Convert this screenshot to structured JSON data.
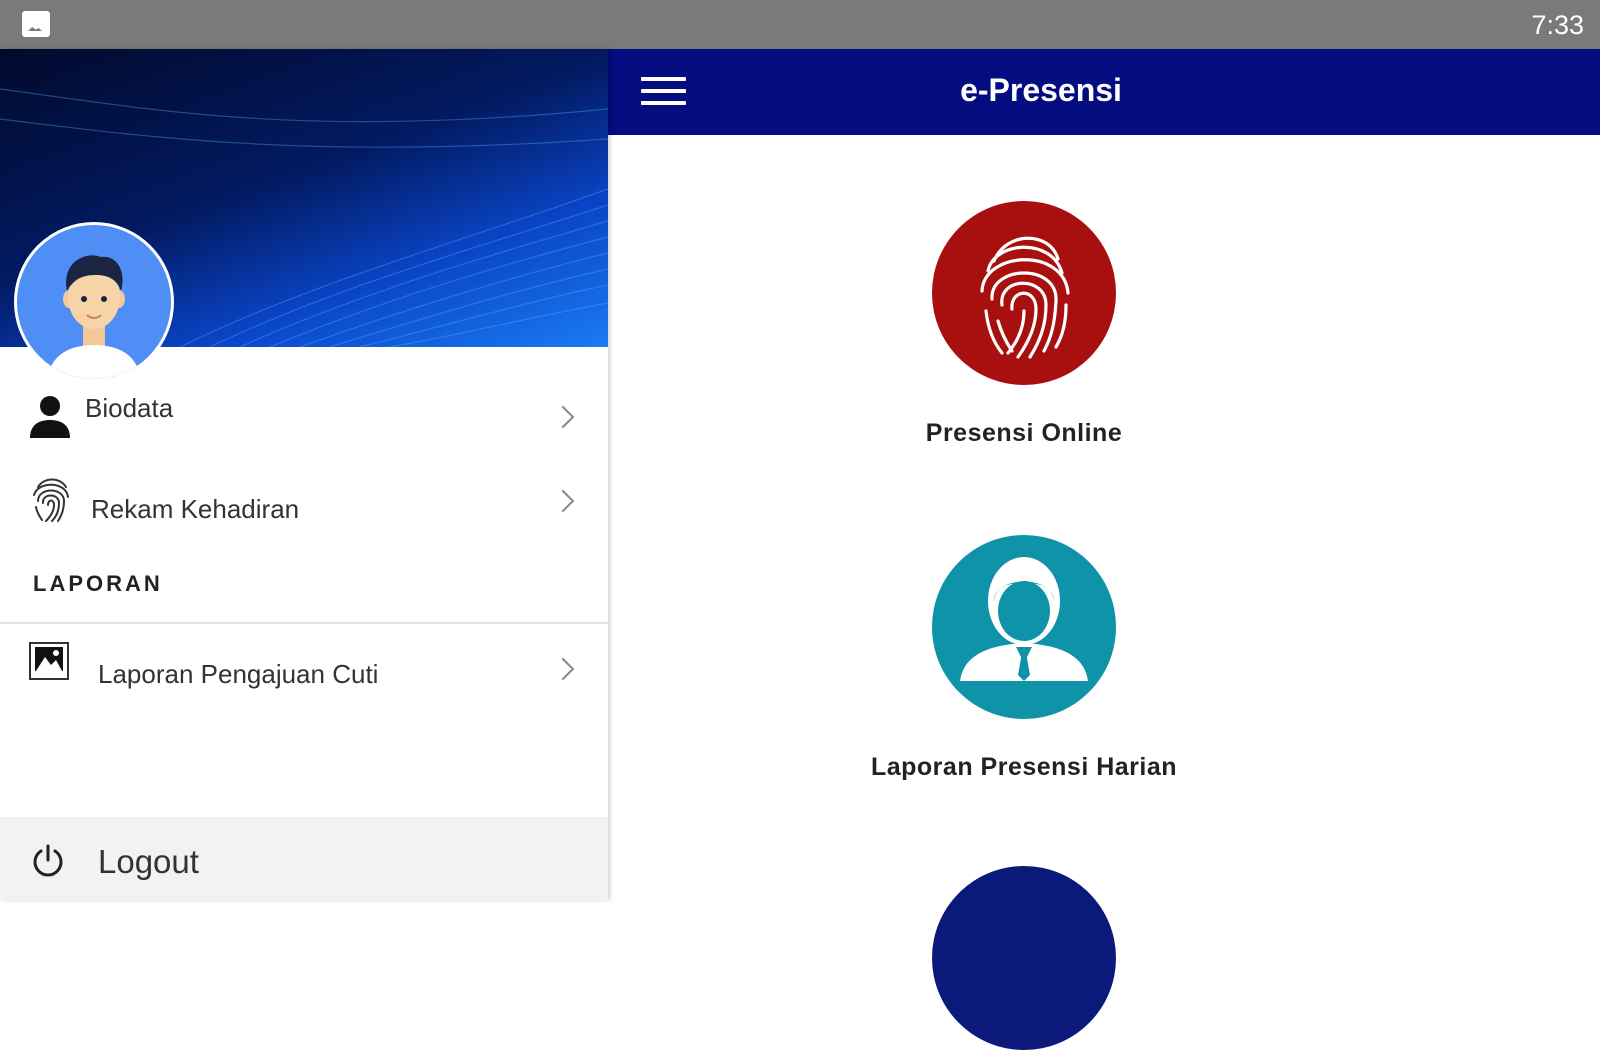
{
  "status_bar": {
    "time": "7:33"
  },
  "app_bar": {
    "title": "e-Presensi"
  },
  "drawer": {
    "items": [
      {
        "label": "Biodata"
      },
      {
        "label": "Rekam Kehadiran"
      }
    ],
    "section_title": "LAPORAN",
    "report_items": [
      {
        "label": "Laporan Pengajuan Cuti"
      }
    ],
    "logout_label": "Logout"
  },
  "main": {
    "tiles": [
      {
        "label": "Presensi Online",
        "color": "#a80f0f"
      },
      {
        "label": "Laporan Presensi Harian",
        "color": "#0e93a8"
      }
    ],
    "partial_tile_color": "#0b1a7a"
  },
  "colors": {
    "app_bar": "#030d80",
    "status_bar": "#7a7a7a",
    "drawer_header": "#021a62",
    "avatar_bg": "#4e8ef5"
  }
}
